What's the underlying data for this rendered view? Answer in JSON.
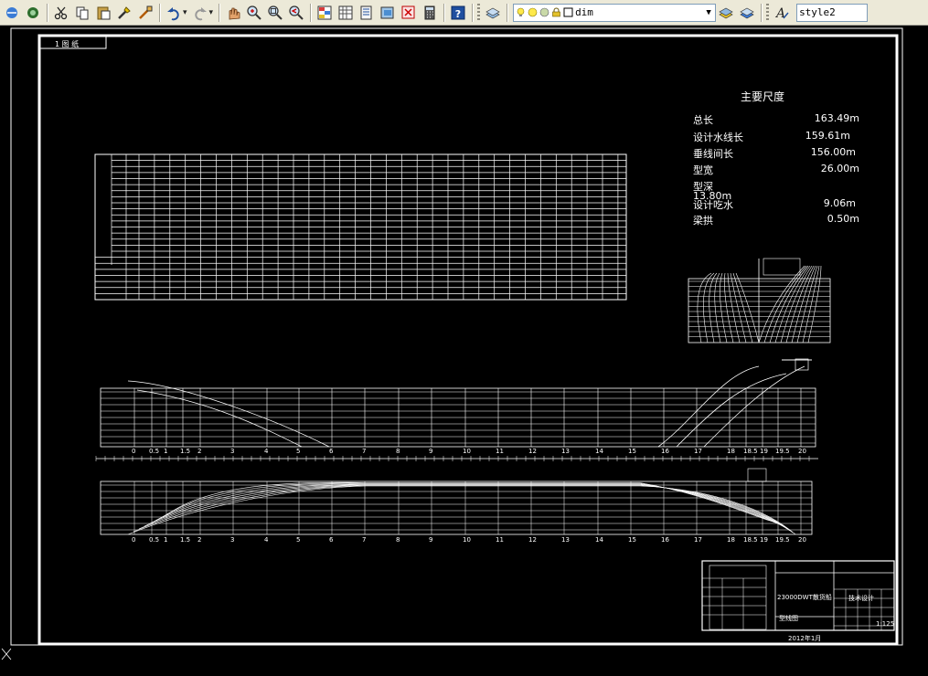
{
  "toolbar": {
    "layer_name": "dim",
    "text_style": "style2"
  },
  "icons": [
    "undo-icon",
    "redo-icon",
    "pan-icon",
    "zoom-realtime-icon",
    "zoom-window-icon",
    "zoom-previous-icon",
    "properties-icon",
    "design-center-icon",
    "tool-palettes-icon",
    "sheet-set-icon",
    "markup-icon",
    "calculator-icon",
    "help-icon"
  ],
  "drawing": {
    "title_tab": "1 图 纸",
    "main_dimensions": {
      "heading": "主要尺度",
      "rows": [
        {
          "label": "总长",
          "value": "163.49m"
        },
        {
          "label": "设计水线长",
          "value": "159.61m"
        },
        {
          "label": "垂线间长",
          "value": "156.00m"
        },
        {
          "label": "型宽",
          "value": "26.00m"
        },
        {
          "label": "型深",
          "value": "13.80m"
        },
        {
          "label": "设计吃水",
          "value": "9.06m"
        },
        {
          "label": "梁拱",
          "value": "0.50m"
        }
      ]
    },
    "stations_upper": [
      "0",
      "0.5",
      "1",
      "1.5",
      "2",
      "3",
      "4",
      "5",
      "6",
      "7",
      "8",
      "9",
      "10",
      "11",
      "12",
      "13",
      "14",
      "15",
      "16",
      "17",
      "18",
      "18.5",
      "19",
      "19.5",
      "20"
    ],
    "stations_lower": [
      "0",
      "0.5",
      "1",
      "1.5",
      "2",
      "3",
      "4",
      "5",
      "6",
      "7",
      "8",
      "9",
      "10",
      "11",
      "12",
      "13",
      "14",
      "15",
      "16",
      "17",
      "18",
      "18.5",
      "19",
      "19.5",
      "20"
    ],
    "title_block": {
      "project": "23000DWT散货船",
      "drawing": "型线图",
      "company": "技术设计",
      "scale": "1:125",
      "date": "2012年1月"
    }
  }
}
